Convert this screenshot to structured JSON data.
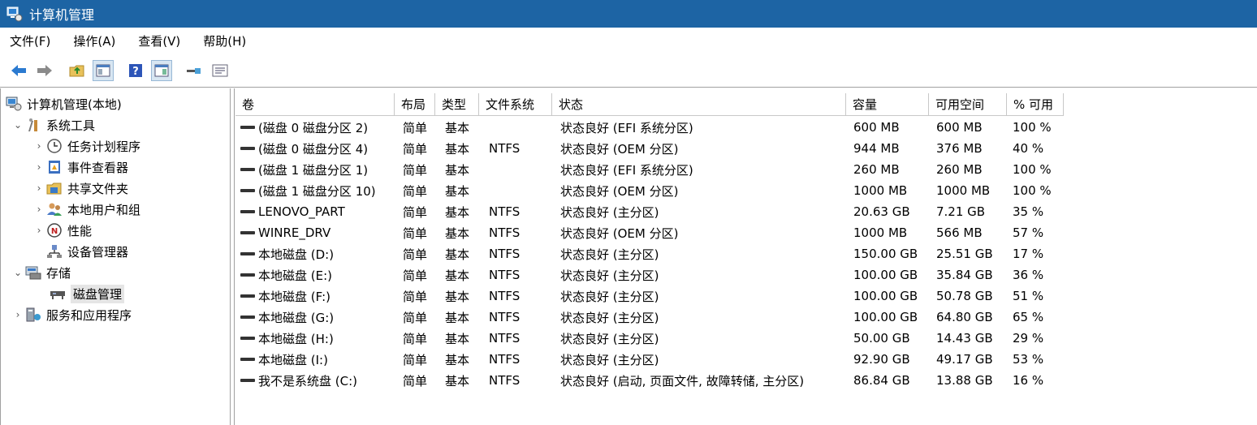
{
  "window": {
    "title": "计算机管理"
  },
  "menu": [
    "文件(F)",
    "操作(A)",
    "查看(V)",
    "帮助(H)"
  ],
  "tree": {
    "root": "计算机管理(本地)",
    "system_tools": "系统工具",
    "task_scheduler": "任务计划程序",
    "event_viewer": "事件查看器",
    "shared_folders": "共享文件夹",
    "local_users": "本地用户和组",
    "performance": "性能",
    "device_manager": "设备管理器",
    "storage": "存储",
    "disk_management": "磁盘管理",
    "services": "服务和应用程序"
  },
  "columns": [
    "卷",
    "布局",
    "类型",
    "文件系统",
    "状态",
    "容量",
    "可用空间",
    "% 可用"
  ],
  "volumes": [
    [
      "(磁盘 0 磁盘分区 2)",
      "简单",
      "基本",
      "",
      "状态良好 (EFI 系统分区)",
      "600 MB",
      "600 MB",
      "100 %"
    ],
    [
      "(磁盘 0 磁盘分区 4)",
      "简单",
      "基本",
      "NTFS",
      "状态良好 (OEM 分区)",
      "944 MB",
      "376 MB",
      "40 %"
    ],
    [
      "(磁盘 1 磁盘分区 1)",
      "简单",
      "基本",
      "",
      "状态良好 (EFI 系统分区)",
      "260 MB",
      "260 MB",
      "100 %"
    ],
    [
      "(磁盘 1 磁盘分区 10)",
      "简单",
      "基本",
      "",
      "状态良好 (OEM 分区)",
      "1000 MB",
      "1000 MB",
      "100 %"
    ],
    [
      "LENOVO_PART",
      "简单",
      "基本",
      "NTFS",
      "状态良好 (主分区)",
      "20.63 GB",
      "7.21 GB",
      "35 %"
    ],
    [
      "WINRE_DRV",
      "简单",
      "基本",
      "NTFS",
      "状态良好 (OEM 分区)",
      "1000 MB",
      "566 MB",
      "57 %"
    ],
    [
      "本地磁盘 (D:)",
      "简单",
      "基本",
      "NTFS",
      "状态良好 (主分区)",
      "150.00 GB",
      "25.51 GB",
      "17 %"
    ],
    [
      "本地磁盘 (E:)",
      "简单",
      "基本",
      "NTFS",
      "状态良好 (主分区)",
      "100.00 GB",
      "35.84 GB",
      "36 %"
    ],
    [
      "本地磁盘 (F:)",
      "简单",
      "基本",
      "NTFS",
      "状态良好 (主分区)",
      "100.00 GB",
      "50.78 GB",
      "51 %"
    ],
    [
      "本地磁盘 (G:)",
      "简单",
      "基本",
      "NTFS",
      "状态良好 (主分区)",
      "100.00 GB",
      "64.80 GB",
      "65 %"
    ],
    [
      "本地磁盘 (H:)",
      "简单",
      "基本",
      "NTFS",
      "状态良好 (主分区)",
      "50.00 GB",
      "14.43 GB",
      "29 %"
    ],
    [
      "本地磁盘 (I:)",
      "简单",
      "基本",
      "NTFS",
      "状态良好 (主分区)",
      "92.90 GB",
      "49.17 GB",
      "53 %"
    ],
    [
      "我不是系统盘 (C:)",
      "简单",
      "基本",
      "NTFS",
      "状态良好 (启动, 页面文件, 故障转储, 主分区)",
      "86.84 GB",
      "13.88 GB",
      "16 %"
    ]
  ]
}
